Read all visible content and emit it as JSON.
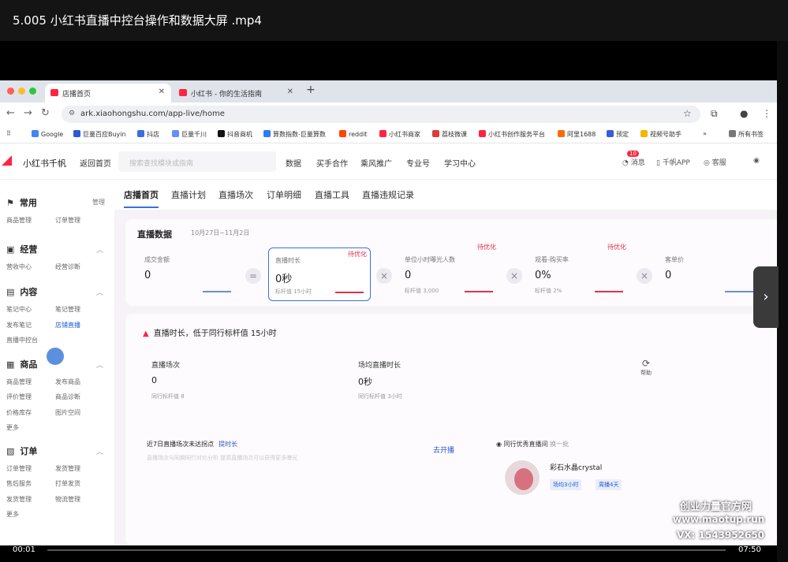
{
  "player": {
    "title": "5.005 小红书直播中控台操作和数据大屏 .mp4",
    "time_current": "00:01",
    "time_total": "07:50"
  },
  "browser": {
    "tabs": [
      {
        "label": "店播首页",
        "active": true
      },
      {
        "label": "小红书 - 你的生活指南",
        "active": false
      }
    ],
    "url": "ark.xiaohongshu.com/app-live/home",
    "bookmarks": [
      "Google",
      "巨量百应Buyin",
      "抖店",
      "巨量千川",
      "抖音商机",
      "算数指数-巨量算数",
      "reddit",
      "小红书商家",
      "荔枝微课",
      "小红书创作服务平台",
      "阿里1688",
      "预定",
      "视频号助手",
      "所有书签"
    ]
  },
  "app": {
    "brand": "小红书千帆",
    "back": "返回首页",
    "search_placeholder": "搜索查找模块或指南",
    "nav": [
      "数据",
      "买手合作",
      "乘风推广",
      "专业号",
      "学习中心"
    ],
    "right": {
      "msg": "消息",
      "msg_count": "10",
      "app": "千帆APP",
      "service": "客服"
    }
  },
  "sidebar": {
    "manage": "管理",
    "sections": [
      {
        "title": "常用",
        "items": [
          "商品管理",
          "订单管理"
        ]
      },
      {
        "title": "经营",
        "items": [
          "营收中心",
          "经营诊断"
        ]
      },
      {
        "title": "内容",
        "items": [
          "笔记中心",
          "笔记管理",
          "发布笔记",
          "店铺直播",
          "直播中控台"
        ]
      },
      {
        "title": "商品",
        "items": [
          "商品管理",
          "发布商品",
          "评价管理",
          "商品诊断",
          "价格库存",
          "图片空间",
          "更多"
        ]
      },
      {
        "title": "订单",
        "items": [
          "订单管理",
          "发货管理",
          "售后服务",
          "打单发货",
          "发货管理",
          "物流管理",
          "更多"
        ]
      }
    ]
  },
  "main": {
    "tabs": [
      "店播首页",
      "直播计划",
      "直播场次",
      "订单明细",
      "直播工具",
      "直播违规记录"
    ],
    "data_title": "直播数据",
    "data_date": "10月27日~11月2日",
    "metrics": [
      {
        "label": "成交金额",
        "value": "0",
        "sub": ""
      },
      {
        "label": "直播时长",
        "value": "0秒",
        "sub": "标杆值 15小时",
        "tag": "待优化"
      },
      {
        "label": "单位小时曝光人数",
        "value": "0",
        "sub": "标杆值 3,000",
        "tag": "待优化"
      },
      {
        "label": "观看-购买率",
        "value": "0%",
        "sub": "标杆值 2%",
        "tag": "待优化"
      },
      {
        "label": "客单价",
        "value": "0",
        "sub": ""
      }
    ],
    "ops": [
      "=",
      "×",
      "×",
      "×"
    ],
    "warning": "直播时长，低于同行标杆值 15小时",
    "stats": [
      {
        "label": "直播场次",
        "value": "0",
        "sub": "同行标杆值 8"
      },
      {
        "label": "场均直播时长",
        "value": "0秒",
        "sub": "同行标杆值 3小时"
      }
    ],
    "reason_title": "近7日直播场次未达拐点",
    "reason_link": "提时长",
    "reason_hint": "直播场次与同期同行对比分析   提高直播场次可以获得更多曝光",
    "open": "去开播",
    "peer_title": "同行优秀直播间",
    "peer_more": "换一批",
    "peer_name": "彩石水晶crystal",
    "peer_chips": [
      "场均3小时",
      "周播4天"
    ],
    "help": "帮助"
  },
  "watermark": [
    "创业力量官方网",
    "www.maotup.run",
    "VX: 1543952650"
  ],
  "colors": {
    "accent": "#3b6fe0",
    "brand": "#ff2442",
    "warn": "#e0314b"
  }
}
